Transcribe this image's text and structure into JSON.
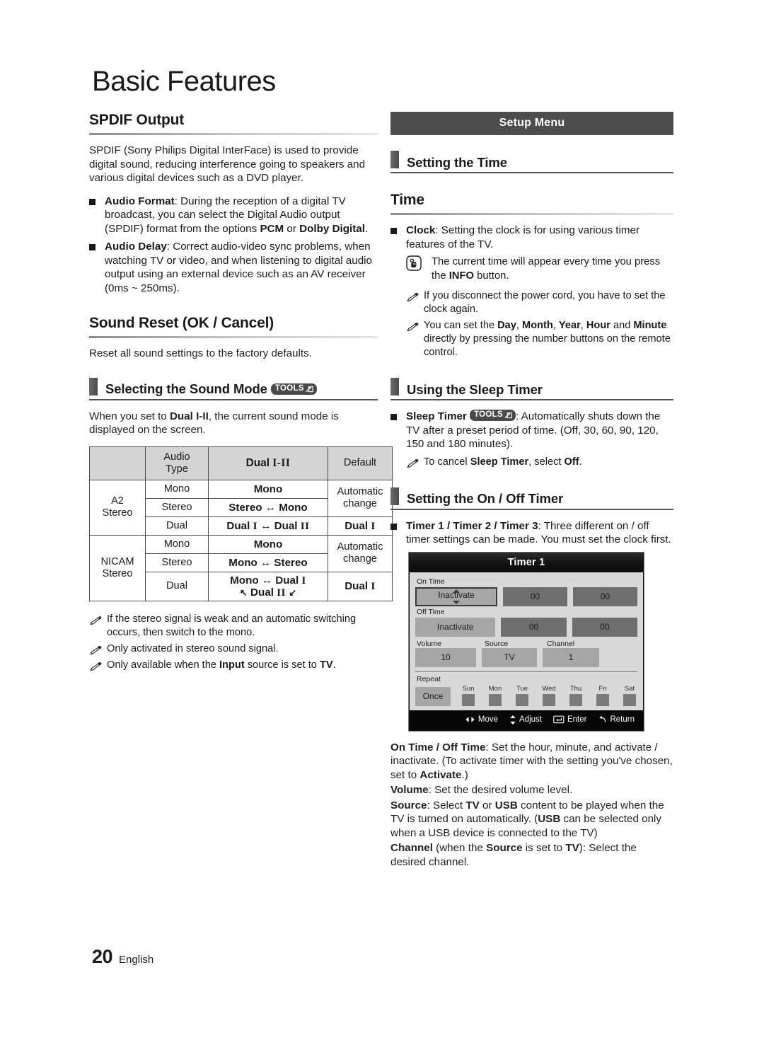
{
  "chapter_title": "Basic Features",
  "footer": {
    "page_number": "20",
    "language": "English"
  },
  "left_column": {
    "spdif": {
      "heading": "SPDIF Output",
      "intro": "SPDIF (Sony Philips Digital InterFace) is used to provide digital sound, reducing interference going to speakers and various digital devices such as a DVD player.",
      "bullets": [
        {
          "term": "Audio Format",
          "text": ": During the reception of a digital TV broadcast, you can select the Digital Audio output (SPDIF) format from the options ",
          "bold_a": "PCM",
          "mid": " or ",
          "bold_b": "Dolby Digital",
          "tail": "."
        },
        {
          "term": "Audio Delay",
          "text": ": Correct audio-video sync problems, when watching TV or video, and when listening to digital audio output using an external device such as an AV receiver (0ms ~ 250ms)."
        }
      ]
    },
    "sound_reset": {
      "heading": "Sound Reset (OK / Cancel)",
      "text": "Reset all sound settings to the factory defaults."
    },
    "sound_mode": {
      "heading": "Selecting the Sound Mode",
      "badge": "TOOLS",
      "intro_a": "When you set to ",
      "intro_bold": "Dual I-II",
      "intro_b": ", the current sound mode is displayed on the screen."
    },
    "sound_table": {
      "headers": [
        "",
        "Audio Type",
        "Dual I-II",
        "Default"
      ],
      "groups": [
        {
          "name": "A2 Stereo",
          "rows": [
            {
              "audio_type": "Mono",
              "dual": "Mono",
              "default": "Automatic change"
            },
            {
              "audio_type": "Stereo",
              "dual": "Stereo ↔ Mono",
              "default": ""
            },
            {
              "audio_type": "Dual",
              "dual": "Dual I ↔ Dual II",
              "default": "Dual I"
            }
          ]
        },
        {
          "name": "NICAM Stereo",
          "rows": [
            {
              "audio_type": "Mono",
              "dual": "Mono",
              "default": "Automatic change"
            },
            {
              "audio_type": "Stereo",
              "dual": "Mono ↔ Stereo",
              "default": ""
            },
            {
              "audio_type": "Dual",
              "dual": "Mono ↔ Dual I",
              "dual2": "↖ Dual II ↙",
              "default": "Dual I"
            }
          ]
        }
      ]
    },
    "notes": [
      "If the stereo signal is weak and an automatic switching occurs, then switch to the mono.",
      "Only activated in stereo sound signal.",
      "Only available when the Input source is set to TV."
    ],
    "note3_parts": {
      "a": "Only available when the ",
      "b": "Input",
      "c": " source is set to ",
      "d": "TV",
      "e": "."
    }
  },
  "right_column": {
    "setup_banner": "Setup Menu",
    "setting_time_heading": "Setting the Time",
    "time_heading": "Time",
    "clock_bullet": {
      "term": "Clock",
      "text": ": Setting the clock is for using various timer features of the TV."
    },
    "press_note": {
      "a": "The current time will appear every time you press the ",
      "b": "INFO",
      "c": " button."
    },
    "notes": [
      {
        "a": "If you disconnect the power cord, you have to set the clock again."
      },
      {
        "a": "You can set the ",
        "b1": "Day",
        "s1": ", ",
        "b2": "Month",
        "s2": ", ",
        "b3": "Year",
        "s3": ", ",
        "b4": "Hour",
        "s4": " and ",
        "b5": "Minute",
        "s5": " directly by pressing the number buttons on the remote control."
      }
    ],
    "sleep_timer_heading": "Using the Sleep Timer",
    "sleep_timer_bullet": {
      "term": "Sleep Timer",
      "badge": "TOOLS",
      "text": ": Automatically shuts down the TV after a preset period of time. (Off, 30, 60, 90, 120, 150 and 180 minutes)."
    },
    "sleep_timer_note": {
      "a": "To cancel ",
      "b": "Sleep Timer",
      "c": ", select ",
      "d": "Off",
      "e": "."
    },
    "onoff_timer_heading": "Setting the On / Off Timer",
    "onoff_bullet": {
      "term": "Timer 1 / Timer 2 / Timer 3",
      "text": ": Three different on / off timer settings can be made. You must set the clock first."
    },
    "timer_osd": {
      "title": "Timer 1",
      "on_time_label": "On Time",
      "on_time_state": "Inactivate",
      "on_time_hour": "00",
      "on_time_minute": "00",
      "off_time_label": "Off Time",
      "off_time_state": "Inactivate",
      "off_time_hour": "00",
      "off_time_minute": "00",
      "volume_label": "Volume",
      "volume_value": "10",
      "source_label": "Source",
      "source_value": "TV",
      "channel_label": "Channel",
      "channel_value": "1",
      "repeat_label": "Repeat",
      "repeat_value": "Once",
      "days": [
        "Sun",
        "Mon",
        "Tue",
        "Wed",
        "Thu",
        "Fri",
        "Sat"
      ],
      "footer_actions": [
        "Move",
        "Adjust",
        "Enter",
        "Return"
      ]
    },
    "descriptions": [
      {
        "term": "On Time / Off Time",
        "a": ": Set the hour, minute, and activate / inactivate. (To activate timer with the setting you've chosen, set to ",
        "b": "Activate",
        "c": ".)"
      },
      {
        "term": "Volume",
        "a": ": Set the desired volume level."
      },
      {
        "term": "Source",
        "a": ": Select ",
        "b": "TV",
        "c": " or ",
        "d": "USB",
        "e": " content to be played when the TV is turned on automatically. (",
        "f": "USB",
        "g": " can be selected only when a USB device is connected to the TV)"
      },
      {
        "term": "Channel",
        "a": " (when the ",
        "b": "Source",
        "c": " is set to ",
        "d": "TV",
        "e": "): Select the desired channel."
      }
    ]
  },
  "colors": {
    "banner_bg": "#4d4d4d",
    "heading_bar": "#555555",
    "table_header_bg": "#d4d4d4",
    "osd_bg": "#d8d8d8",
    "osd_field": "#a6a6a6",
    "osd_field_dark": "#6e6e6e",
    "osd_title_bg": "#111111"
  }
}
